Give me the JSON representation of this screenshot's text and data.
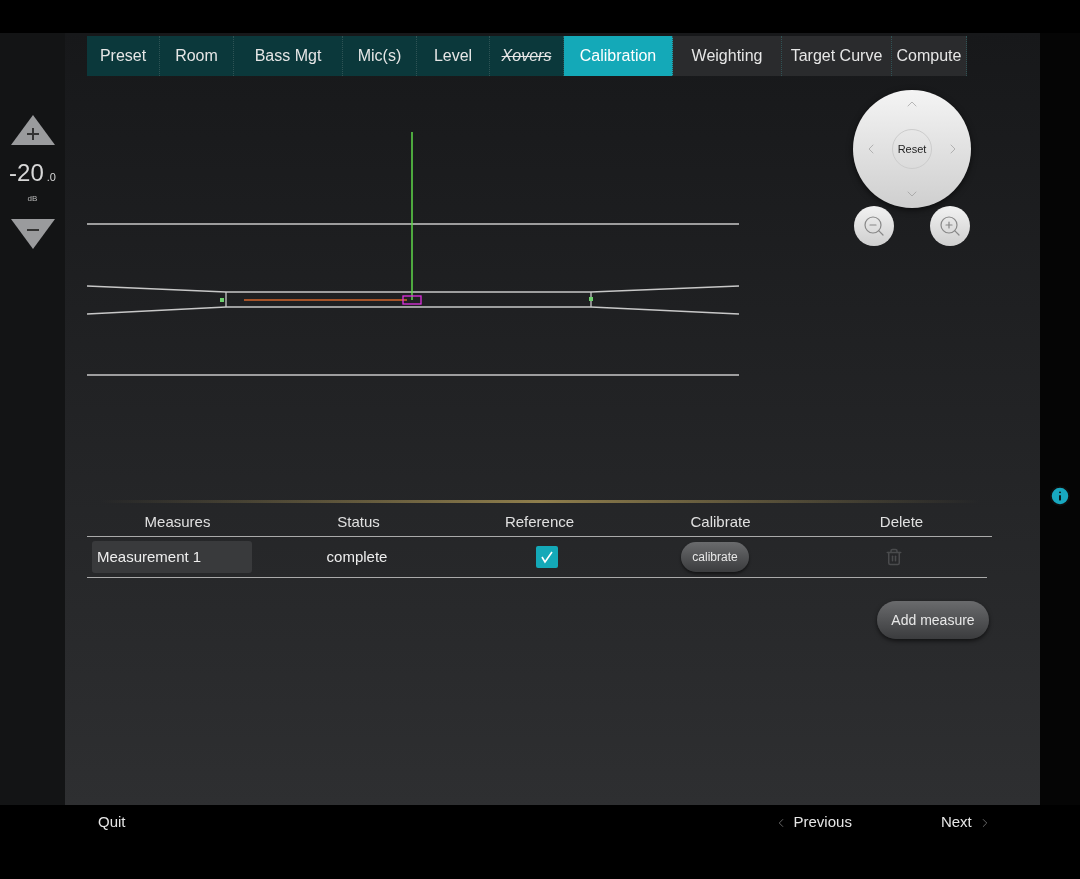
{
  "tabs": [
    {
      "label": "Preset",
      "selected": false,
      "done": true,
      "disabled": false
    },
    {
      "label": "Room",
      "selected": false,
      "done": true,
      "disabled": false
    },
    {
      "label": "Bass Mgt",
      "selected": false,
      "done": true,
      "disabled": false
    },
    {
      "label": "Mic(s)",
      "selected": false,
      "done": true,
      "disabled": false
    },
    {
      "label": "Level",
      "selected": false,
      "done": true,
      "disabled": false
    },
    {
      "label": "Xovers",
      "selected": false,
      "done": true,
      "disabled": true
    },
    {
      "label": "Calibration",
      "selected": true,
      "done": false,
      "disabled": false
    },
    {
      "label": "Weighting",
      "selected": false,
      "done": false,
      "disabled": false
    },
    {
      "label": "Target Curve",
      "selected": false,
      "done": false,
      "disabled": false
    },
    {
      "label": "Compute",
      "selected": false,
      "done": false,
      "disabled": false
    }
  ],
  "level_control": {
    "value": "-20",
    "decimal": ".0",
    "unit": "dB"
  },
  "view_pad": {
    "reset": "Reset"
  },
  "table": {
    "columns": [
      "Measures",
      "Status",
      "Reference",
      "Calibrate",
      "Delete"
    ],
    "rows": [
      {
        "measure": "Measurement 1",
        "status": "complete",
        "reference": true,
        "calibrate": "calibrate"
      }
    ]
  },
  "add_button": "Add measure",
  "footer": {
    "quit": "Quit",
    "previous": "Previous",
    "next": "Next"
  }
}
